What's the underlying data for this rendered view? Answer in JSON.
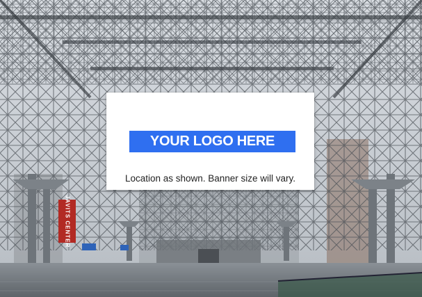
{
  "banner": {
    "logo_text": "YOUR LOGO HERE",
    "caption": "Location as shown. Banner size will vary."
  },
  "sign": {
    "text": "JAVITS CENTER"
  },
  "colors": {
    "logo_bg": "#2f6ff0",
    "sign_red": "#b22a24"
  }
}
